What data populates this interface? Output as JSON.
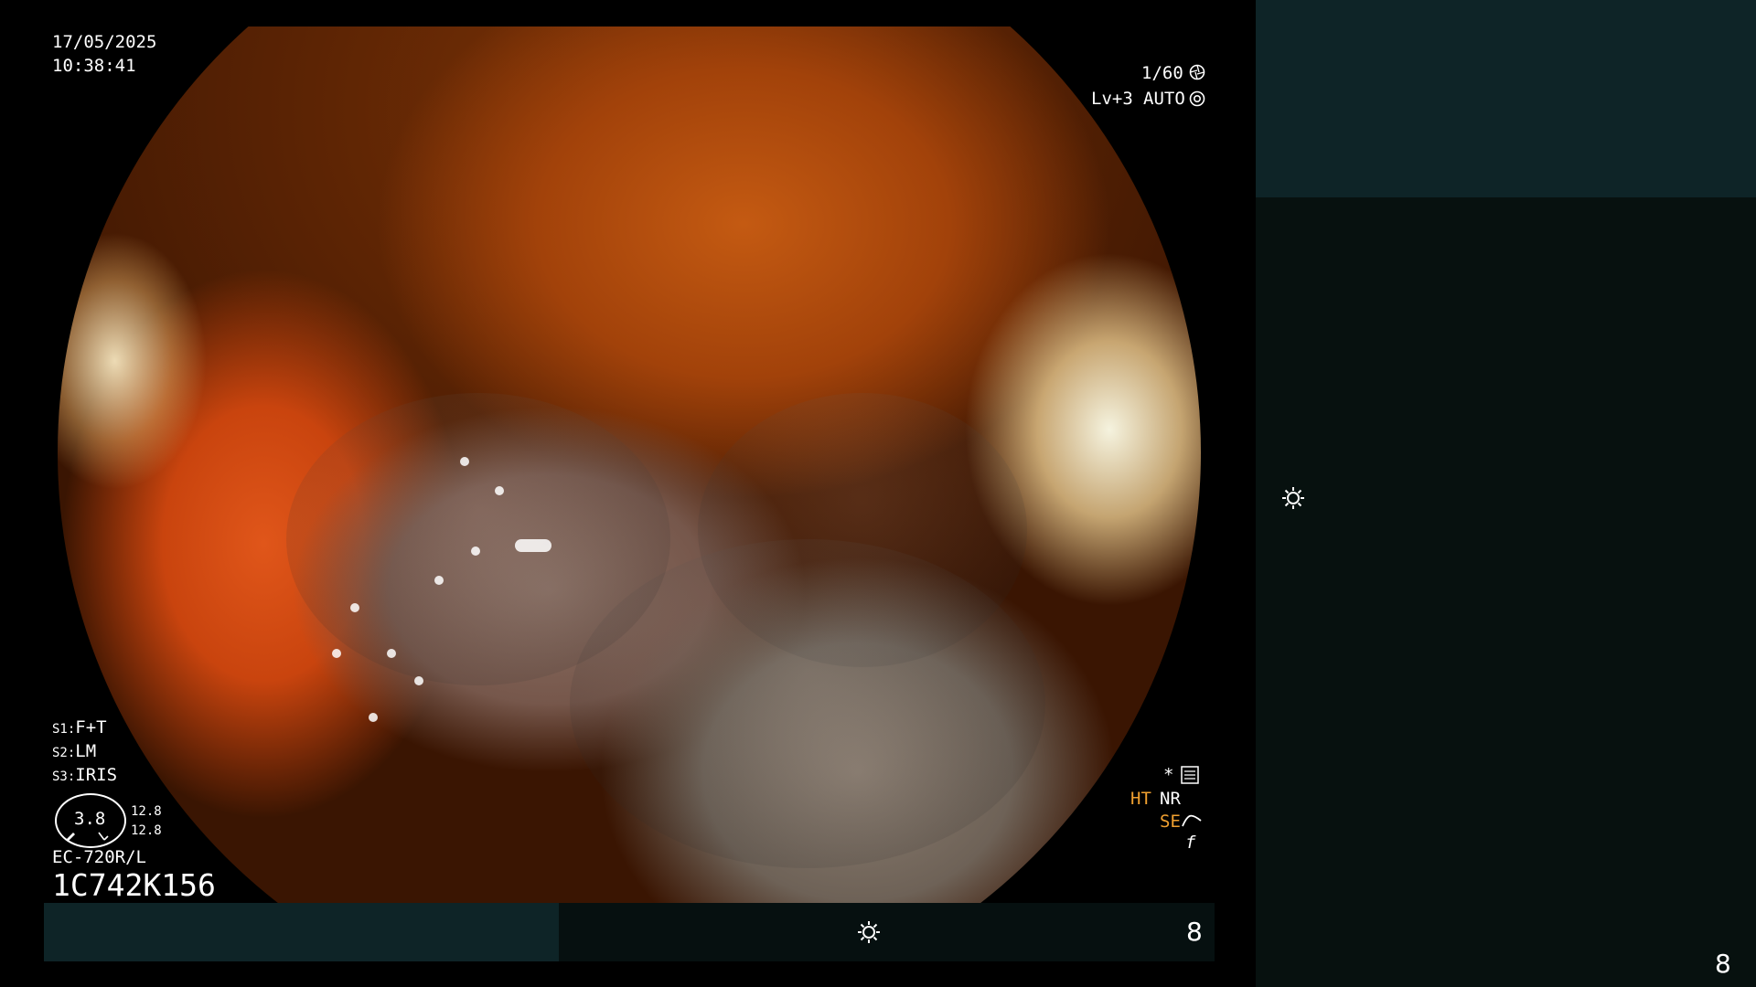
{
  "osd": {
    "date": "17/05/2025",
    "time": "10:38:41",
    "shutter": "1/60",
    "level": "Lv+3",
    "iris_mode": "AUTO",
    "s1": "F+T",
    "s2": "LM",
    "s3": "IRIS",
    "s1_label": "S1:",
    "s2_label": "S2:",
    "s3_label": "S3:",
    "gauge_value": "3.8",
    "gauge_top": "12.8",
    "gauge_bottom": "12.8",
    "scope_model": "EC-720R/L",
    "scope_serial": "1C742K156",
    "star": "*",
    "ht": "HT",
    "nr": "NR",
    "se": "SE",
    "f_glyph": "f"
  },
  "bottom_bar": {
    "value": "8",
    "progress": 0.44
  },
  "right_panel": {
    "value": "8"
  },
  "colors": {
    "panel_dark": "#07110f",
    "panel_teal": "#0e2427",
    "osd_orange": "#f0a030"
  }
}
